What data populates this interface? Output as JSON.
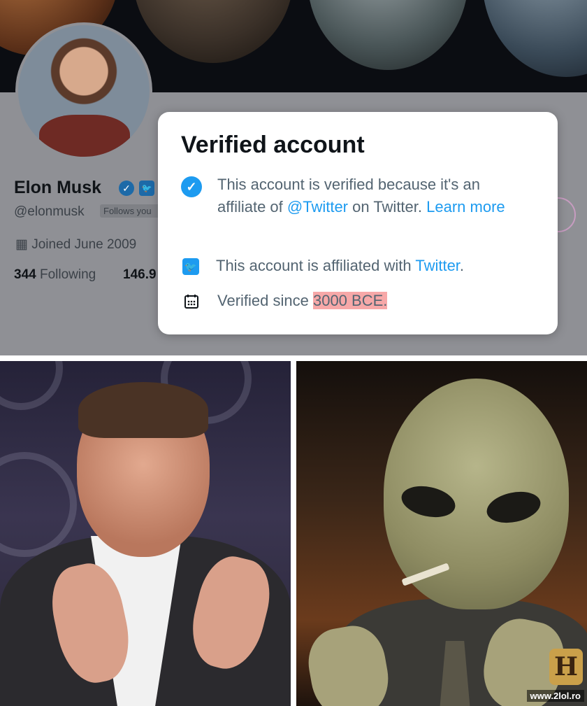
{
  "profile": {
    "name": "Elon Musk",
    "handle": "@elonmusk",
    "follows_you_label": "Follows you",
    "joined": "Joined June 2009",
    "following_count": "344",
    "following_label": "Following",
    "followers_count_partial": "146.9"
  },
  "popup": {
    "title": "Verified account",
    "row1_text": "This account is verified because it's an affiliate of ",
    "row1_mention": "@Twitter",
    "row1_suffix": " on Twitter. ",
    "row1_link": "Learn more",
    "row2_text": "This account is affiliated with ",
    "row2_link": "Twitter",
    "row2_suffix": ".",
    "row3_text": "Verified since ",
    "row3_highlight": "3000 BCE."
  },
  "icons": {
    "verified": "verified-badge-icon",
    "twitter": "twitter-logo-icon",
    "calendar": "calendar-icon"
  },
  "colors": {
    "accent": "#1d9bf0",
    "highlight": "#f7a8a8"
  },
  "meme": {
    "channel_logo": "H",
    "watermark": "www.2lol.ro"
  }
}
